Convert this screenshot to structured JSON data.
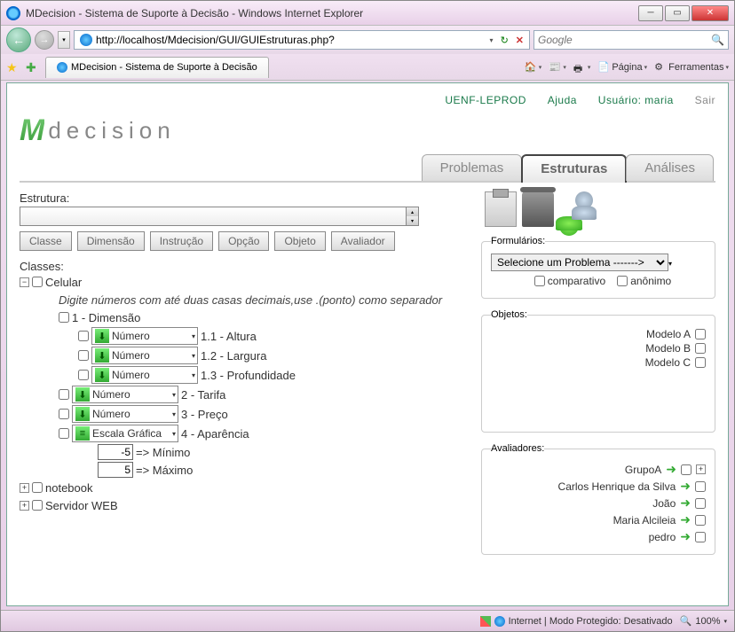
{
  "window": {
    "title": "MDecision - Sistema de Suporte à  Decisão - Windows Internet Explorer"
  },
  "nav": {
    "url": "http://localhost/Mdecision/GUI/GUIEstruturas.php?",
    "search_placeholder": "Google"
  },
  "tab": {
    "title": "MDecision - Sistema de Suporte à  Decisão"
  },
  "toolbar": {
    "pagina": "Página",
    "ferramentas": "Ferramentas"
  },
  "top_links": {
    "uenf": "UENF-LEPROD",
    "ajuda": "Ajuda",
    "usuario": "Usuário: maria",
    "sair": "Sair"
  },
  "logo": {
    "mark": "M",
    "text": "decision"
  },
  "main_tabs": {
    "problemas": "Problemas",
    "estruturas": "Estruturas",
    "analises": "Análises"
  },
  "left": {
    "estrutura_label": "Estrutura:",
    "buttons": {
      "classe": "Classe",
      "dimensao": "Dimensão",
      "instrucao": "Instrução",
      "opcao": "Opção",
      "objeto": "Objeto",
      "avaliador": "Avaliador"
    },
    "classes_label": "Classes:",
    "tree": {
      "celular": "Celular",
      "hint": "Digite números com até duas casas decimais,use .(ponto) como separador",
      "n1": "1 - Dimensão",
      "type_numero": "Número",
      "type_escala": "Escala Gráfica",
      "i11": "1.1 - Altura",
      "i12": "1.2 - Largura",
      "i13": "1.3 - Profundidade",
      "i2": "2 - Tarifa",
      "i3": "3 - Preço",
      "i4": "4 - Aparência",
      "min_val": "-5",
      "min_lbl": "=> Mínimo",
      "max_val": "5",
      "max_lbl": "=> Máximo",
      "notebook": "notebook",
      "servidor": "Servidor WEB"
    }
  },
  "right": {
    "formularios_label": "Formulários:",
    "select_problema": "Selecione um Problema ------->",
    "comparativo": "comparativo",
    "anonimo": "anônimo",
    "objetos_label": "Objetos:",
    "objetos": [
      "Modelo A",
      "Modelo B",
      "Modelo C"
    ],
    "avaliadores_label": "Avaliadores:",
    "avaliadores": [
      "GrupoA",
      "Carlos Henrique da Silva",
      "João",
      "Maria Alcileia",
      "pedro"
    ]
  },
  "status": {
    "zone": "Internet | Modo Protegido: Desativado",
    "zoom": "100%"
  }
}
